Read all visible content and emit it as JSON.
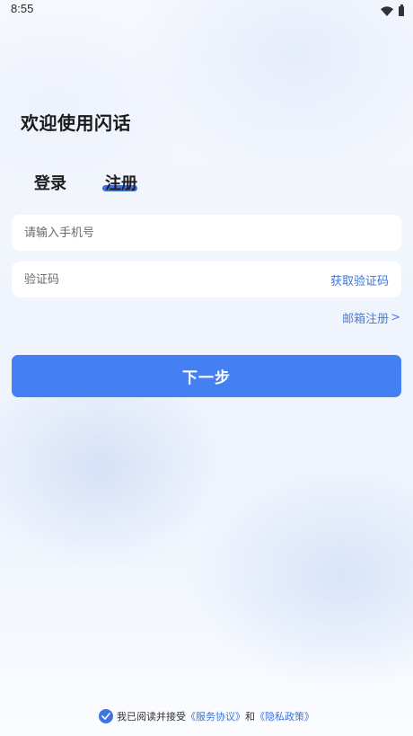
{
  "status_bar": {
    "time": "8:55",
    "icons": [
      "wifi-icon",
      "battery-icon"
    ]
  },
  "welcome_title": "欢迎使用闪话",
  "tabs": [
    {
      "label": "登录",
      "active": false
    },
    {
      "label": "注册",
      "active": true
    }
  ],
  "phone_field": {
    "placeholder": "请输入手机号",
    "value": ""
  },
  "code_field": {
    "placeholder": "验证码",
    "value": "",
    "action_label": "获取验证码"
  },
  "email_register": {
    "label": "邮箱注册",
    "arrow": ">"
  },
  "next_button": {
    "label": "下一步"
  },
  "agreement": {
    "checked": true,
    "prefix": "我已阅读并接受",
    "service_link": "《服务协议》",
    "conjunction": "和",
    "privacy_link": "《隐私政策》"
  },
  "colors": {
    "accent": "#4580f2",
    "link": "#3d74d9",
    "tab_underline": "#3f6fde"
  }
}
